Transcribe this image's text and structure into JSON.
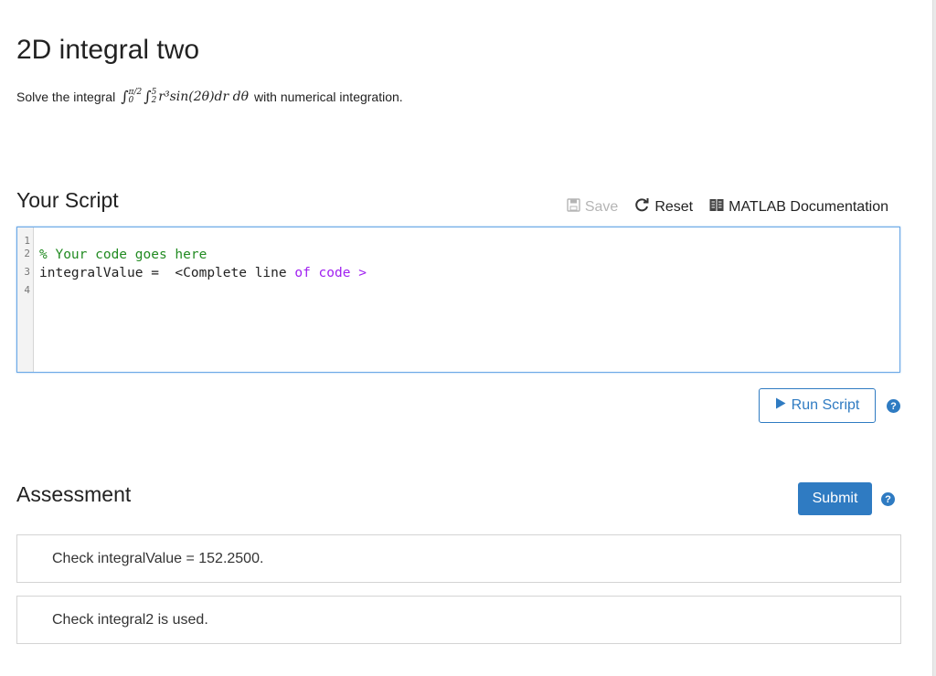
{
  "page": {
    "title": "2D integral two"
  },
  "problem": {
    "prefix": "Solve the integral",
    "math": {
      "outer_upper": "π/2",
      "outer_lower": "0",
      "inner_upper": "5",
      "inner_lower": "2",
      "integrand": "r³sin(2θ)dr dθ"
    },
    "suffix": "with numerical integration."
  },
  "script_section": {
    "heading": "Your Script",
    "toolbar": {
      "save_label": "Save",
      "reset_label": "Reset",
      "docs_label": "MATLAB Documentation"
    },
    "editor": {
      "line_numbers": [
        "1",
        "2",
        "3",
        "4"
      ],
      "lines": [
        {
          "parts": []
        },
        {
          "parts": [
            {
              "text": "% Your code goes here",
              "style": "comment"
            }
          ]
        },
        {
          "parts": [
            {
              "text": "integralValue =  <Complete line ",
              "style": "plain"
            },
            {
              "text": "of code >",
              "style": "kw"
            }
          ]
        },
        {
          "parts": []
        }
      ]
    },
    "run_label": "Run Script"
  },
  "assessment": {
    "heading": "Assessment",
    "submit_label": "Submit",
    "checks": [
      "Check integralValue = 152.2500.",
      "Check integral2 is used."
    ]
  },
  "icons": {
    "save": "save-icon",
    "reset": "reset-icon",
    "docs": "documentation-icon",
    "run": "play-icon",
    "help": "help-icon"
  },
  "colors": {
    "accent": "#2f7bc2",
    "comment": "#228b22",
    "keyword": "#a020f0",
    "editor_border": "#6aa8e6"
  },
  "help_glyph": "?"
}
